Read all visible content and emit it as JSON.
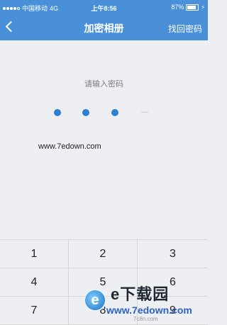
{
  "status_bar": {
    "carrier": "中国移动",
    "network": "4G",
    "time": "上午8:56",
    "battery": "87%"
  },
  "nav": {
    "title": "加密相册",
    "right_link": "找回密码"
  },
  "lock": {
    "prompt": "请输入密码",
    "entered_digits": 3,
    "total_digits": 4
  },
  "watermark_top": "www.7edown.com",
  "keypad": {
    "keys": [
      "1",
      "2",
      "3",
      "4",
      "5",
      "6",
      "7",
      "8",
      "9"
    ]
  },
  "watermark": {
    "logo_letter": "e",
    "title": "e下载园",
    "url": "www.7edown.com",
    "sub": "7c8n.com"
  }
}
